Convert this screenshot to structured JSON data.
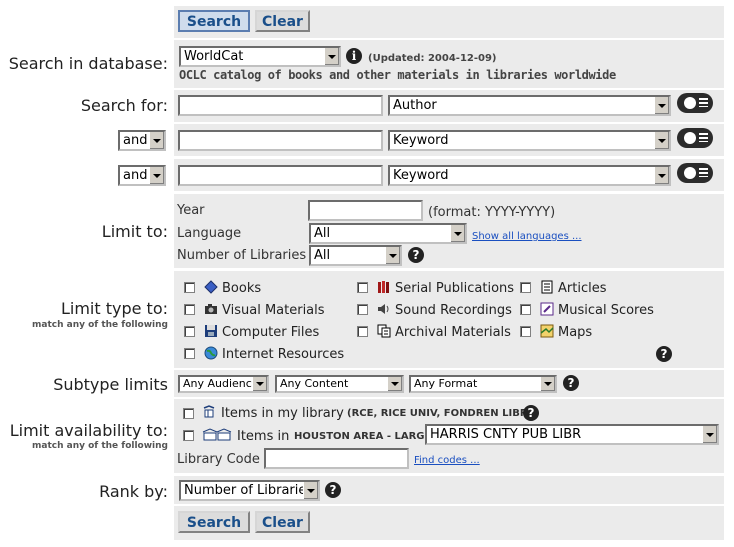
{
  "buttons": {
    "search": "Search",
    "clear": "Clear"
  },
  "database": {
    "label": "Search in database:",
    "selected": "WorldCat",
    "updated": "(Updated: 2004-12-09)",
    "description": "OCLC catalog of books and other materials in libraries worldwide"
  },
  "search": {
    "label": "Search for:",
    "rows": [
      {
        "bool": "",
        "term": "",
        "index": "Author"
      },
      {
        "bool": "and",
        "term": "",
        "index": "Keyword"
      },
      {
        "bool": "and",
        "term": "",
        "index": "Keyword"
      }
    ]
  },
  "limit": {
    "label": "Limit to:",
    "year_label": "Year",
    "year_format": "(format: YYYY-YYYY)",
    "language_label": "Language",
    "language_value": "All",
    "show_languages": "Show all languages ...",
    "libraries_label": "Number of Libraries",
    "libraries_value": "All"
  },
  "type": {
    "label": "Limit type to:",
    "sublabel": "match any of the following",
    "options": [
      "Books",
      "Serial Publications",
      "Articles",
      "Visual Materials",
      "Sound Recordings",
      "Musical Scores",
      "Computer Files",
      "Archival Materials",
      "Maps",
      "Internet Resources"
    ]
  },
  "subtype": {
    "label": "Subtype limits",
    "audience": "Any Audience",
    "content": "Any Content",
    "format": "Any Format"
  },
  "availability": {
    "label": "Limit availability to:",
    "sublabel": "match any of the following",
    "my_library_label": "Items in my library",
    "my_library_detail": "(RCE, RICE UNIV, FONDREN LIBR)",
    "area_label": "Items in",
    "area_detail": "HOUSTON AREA - LARGE",
    "area_library": "HARRIS CNTY PUB LIBR",
    "code_label": "Library Code",
    "find_codes": "Find codes ..."
  },
  "rank": {
    "label": "Rank by:",
    "value": "Number of Libraries"
  },
  "colors": {
    "panel": "#ebebeb",
    "button_text": "#1a4f8a",
    "link": "#1a4fc0"
  }
}
